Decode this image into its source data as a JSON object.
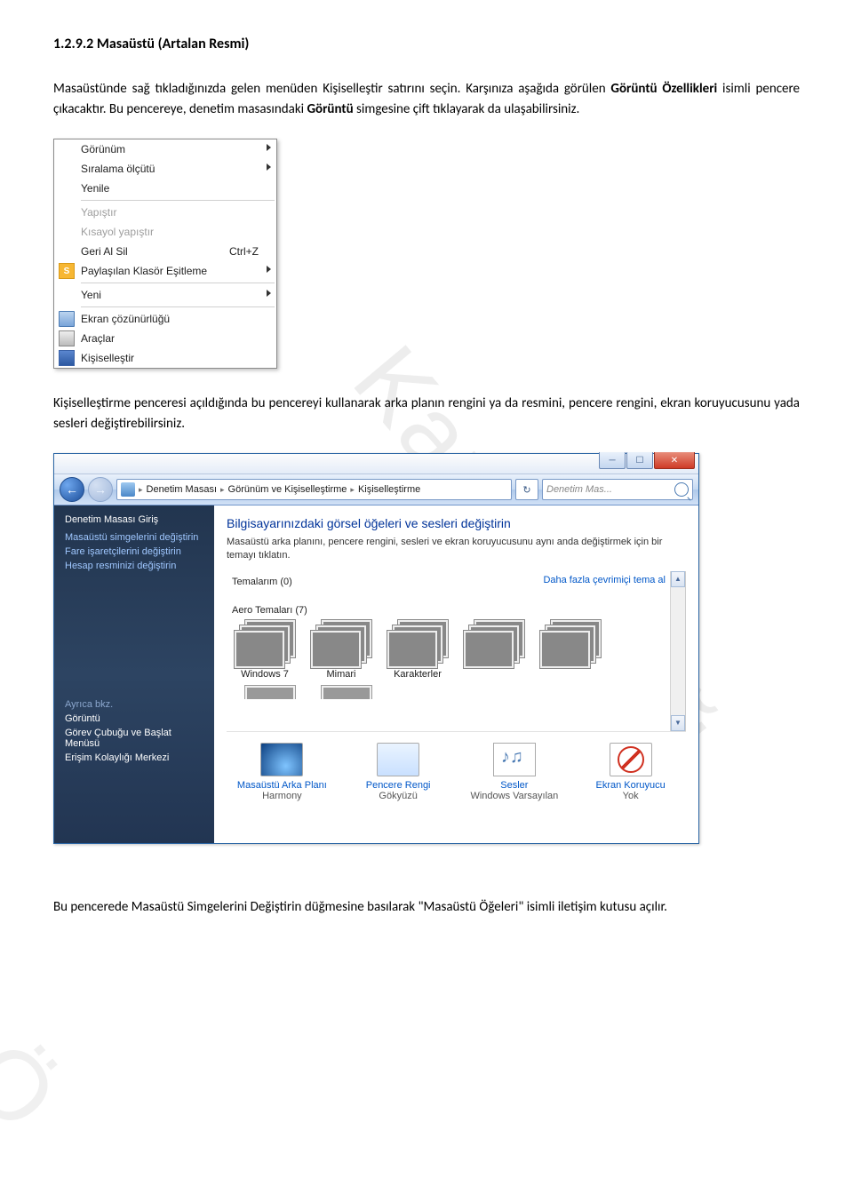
{
  "heading": "1.2.9.2 Masaüstü (Artalan Resmi)",
  "para1_pre": "Masaüstünde sağ tıkladığınızda gelen menüden Kişiselleştir satırını seçin. Karşınıza aşağıda görülen ",
  "para1_bold1": "Görüntü Özellikleri",
  "para1_mid": " isimli pencere çıkacaktır. Bu pencereye, denetim masasındaki ",
  "para1_bold2": "Görüntü",
  "para1_post": " simgesine çift tıklayarak da ulaşabilirsiniz.",
  "para2": "Kişiselleştirme penceresi açıldığında bu pencereyi kullanarak arka planın rengini ya da resmini, pencere rengini, ekran koruyucusunu yada sesleri değiştirebilirsiniz.",
  "para3": "Bu pencerede Masaüstü Simgelerini Değiştirin düğmesine basılarak \"Masaüstü Öğeleri\" isimli iletişim kutusu açılır.",
  "watermark_full": "Karacadağ",
  "watermark_part": "Ö",
  "context_menu": {
    "items": [
      {
        "label": "Görünüm",
        "submenu": true
      },
      {
        "label": "Sıralama ölçütü",
        "submenu": true
      },
      {
        "label": "Yenile"
      },
      {
        "sep": true
      },
      {
        "label": "Yapıştır",
        "disabled": true
      },
      {
        "label": "Kısayol yapıştır",
        "disabled": true
      },
      {
        "label": "Geri Al Sil",
        "shortcut": "Ctrl+Z"
      },
      {
        "icon": "s",
        "label": "Paylaşılan Klasör Eşitleme",
        "submenu": true
      },
      {
        "sep": true
      },
      {
        "label": "Yeni",
        "submenu": true
      },
      {
        "sep": true
      },
      {
        "icon": "monitor",
        "label": "Ekran çözünürlüğü"
      },
      {
        "icon": "tools",
        "label": "Araçlar"
      },
      {
        "icon": "pers",
        "label": "Kişiselleştir"
      }
    ]
  },
  "window": {
    "breadcrumb": [
      "Denetim Masası",
      "Görünüm ve Kişiselleştirme",
      "Kişiselleştirme"
    ],
    "search_placeholder": "Denetim Mas...",
    "sidebar": {
      "heading": "Denetim Masası Giriş",
      "links": [
        "Masaüstü simgelerini değiştirin",
        "Fare işaretçilerini değiştirin",
        "Hesap resminizi değiştirin"
      ],
      "see_also": "Ayrıca bkz.",
      "see_links": [
        "Görüntü",
        "Görev Çubuğu ve Başlat Menüsü",
        "Erişim Kolaylığı Merkezi"
      ]
    },
    "main": {
      "title": "Bilgisayarınızdaki görsel öğeleri ve sesleri değiştirin",
      "subtitle": "Masaüstü arka planını, pencere rengini, sesleri ve ekran koruyucusunu aynı anda değiştirmek için bir temayı tıklatın.",
      "my_themes_label": "Temalarım (0)",
      "more_link": "Daha fazla çevrimiçi tema al",
      "aero_themes_label": "Aero Temaları (7)",
      "themes": [
        {
          "name": "Windows 7",
          "cls": "th-win7"
        },
        {
          "name": "Mimari",
          "cls": "th-mimari"
        },
        {
          "name": "Karakterler",
          "cls": "th-karakter"
        }
      ],
      "bottom": [
        {
          "title": "Masaüstü Arka Planı",
          "sub": "Harmony",
          "icon": "bi-bg"
        },
        {
          "title": "Pencere Rengi",
          "sub": "Gökyüzü",
          "icon": "bi-color"
        },
        {
          "title": "Sesler",
          "sub": "Windows Varsayılan",
          "icon": "bi-sound"
        },
        {
          "title": "Ekran Koruyucu",
          "sub": "Yok",
          "icon": "bi-saver"
        }
      ]
    }
  }
}
